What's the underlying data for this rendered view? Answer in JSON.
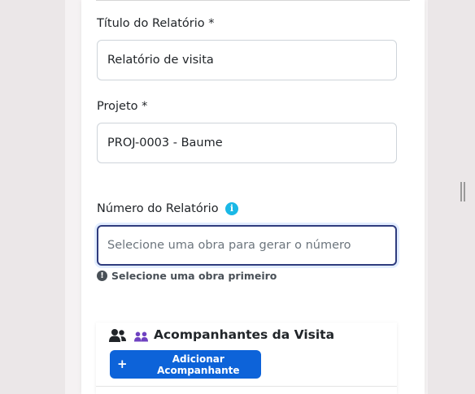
{
  "form": {
    "title_label": "Título do Relatório *",
    "title_value": "Relatório de visita",
    "project_label": "Projeto *",
    "project_value": "PROJ-0003 - Baume",
    "number_label": "Número do Relatório",
    "number_placeholder": "Selecione uma obra para gerar o número",
    "number_hint": "Selecione uma obra primeiro"
  },
  "companions": {
    "title": "Acompanhantes da Visita",
    "add_label": "Adicionar Acompanhante"
  },
  "colors": {
    "primary": "#0d63d9",
    "info": "#1ab8e6",
    "focus_border": "#2f3c7e",
    "people_icon": "#6f42c1"
  }
}
